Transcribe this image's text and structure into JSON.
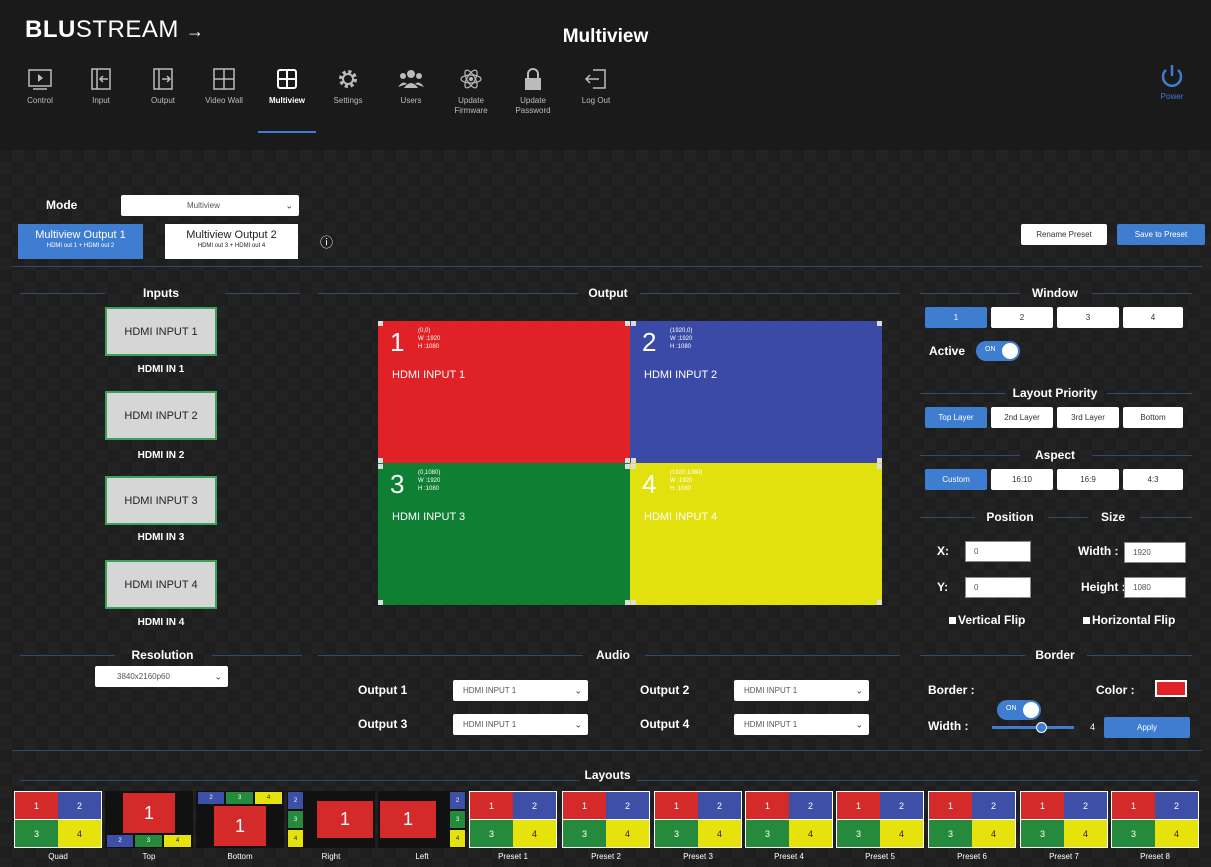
{
  "app": {
    "logo_bold": "BLU",
    "logo_rest": "STREAM",
    "page_title": "Multiview"
  },
  "nav": [
    {
      "label": "Control"
    },
    {
      "label": "Input"
    },
    {
      "label": "Output"
    },
    {
      "label": "Video Wall"
    },
    {
      "label": "Multiview",
      "active": true
    },
    {
      "label": "Settings"
    },
    {
      "label": "Users"
    },
    {
      "label": "Update Firmware"
    },
    {
      "label": "Update Password"
    },
    {
      "label": "Log Out"
    }
  ],
  "power": {
    "label": "Power"
  },
  "mode": {
    "label": "Mode",
    "value": "Multiview"
  },
  "outputs_tabs": [
    {
      "title": "Multiview Output 1",
      "sub": "HDMI out 1 + HDMI out 2",
      "active": true
    },
    {
      "title": "Multiview Output 2",
      "sub": "HDMI out 3 + HDMI out 4",
      "active": false
    }
  ],
  "info_icon": "ⓘ",
  "actions": {
    "rename": "Rename Preset",
    "save": "Save to Preset"
  },
  "inputs": {
    "title": "Inputs",
    "items": [
      {
        "box": "HDMI INPUT 1",
        "label": "HDMI IN 1"
      },
      {
        "box": "HDMI INPUT 2",
        "label": "HDMI IN 2"
      },
      {
        "box": "HDMI INPUT 3",
        "label": "HDMI IN 3"
      },
      {
        "box": "HDMI INPUT 4",
        "label": "HDMI IN 4"
      }
    ]
  },
  "output": {
    "title": "Output",
    "windows": [
      {
        "num": "1",
        "pos": "(0,0)",
        "w": "W :1920",
        "h": "H :1080",
        "name": "HDMI INPUT 1",
        "color": "#e02226"
      },
      {
        "num": "2",
        "pos": "(1920,0)",
        "w": "W :1920",
        "h": "H :1080",
        "name": "HDMI INPUT 2",
        "color": "#3a4aa6"
      },
      {
        "num": "3",
        "pos": "(0,1080)",
        "w": "W :1920",
        "h": "H :1080",
        "name": "HDMI INPUT 3",
        "color": "#0f7f34"
      },
      {
        "num": "4",
        "pos": "(1920,1080)",
        "w": "W :1920",
        "h": "H :1080",
        "name": "HDMI INPUT 4",
        "color": "#e3e10d"
      }
    ]
  },
  "window": {
    "title": "Window",
    "tabs": [
      "1",
      "2",
      "3",
      "4"
    ],
    "active_tab": "1",
    "active_label": "Active",
    "active_toggle": "ON"
  },
  "layout_priority": {
    "title": "Layout Priority",
    "options": [
      "Top Layer",
      "2nd Layer",
      "3rd Layer",
      "Bottom"
    ]
  },
  "aspect": {
    "title": "Aspect",
    "options": [
      "Custom",
      "16:10",
      "16:9",
      "4:3"
    ]
  },
  "position": {
    "title": "Position",
    "x_label": "X:",
    "x": "0",
    "y_label": "Y:",
    "y": "0"
  },
  "size": {
    "title": "Size",
    "w_label": "Width :",
    "w": "1920",
    "h_label": "Height :",
    "h": "1080"
  },
  "flip": {
    "vertical": "Vertical Flip",
    "horizontal": "Horizontal Flip"
  },
  "resolution": {
    "title": "Resolution",
    "value": "3840x2160p60"
  },
  "audio": {
    "title": "Audio",
    "rows": [
      {
        "label": "Output 1",
        "value": "HDMI INPUT 1"
      },
      {
        "label": "Output 2",
        "value": "HDMI INPUT 1"
      },
      {
        "label": "Output 3",
        "value": "HDMI INPUT 1"
      },
      {
        "label": "Output 4",
        "value": "HDMI INPUT 1"
      }
    ]
  },
  "border": {
    "title": "Border",
    "border_label": "Border :",
    "toggle": "ON",
    "color_label": "Color :",
    "color": "#e02226",
    "width_label": "Width :",
    "width_value": "4",
    "width_fraction": 0.6,
    "apply": "Apply"
  },
  "layouts": {
    "title": "Layouts",
    "items": [
      "Quad",
      "Top",
      "Bottom",
      "Right",
      "Left",
      "Preset 1",
      "Preset 2",
      "Preset 3",
      "Preset 4",
      "Preset 5",
      "Preset 6",
      "Preset 7",
      "Preset 8"
    ]
  }
}
